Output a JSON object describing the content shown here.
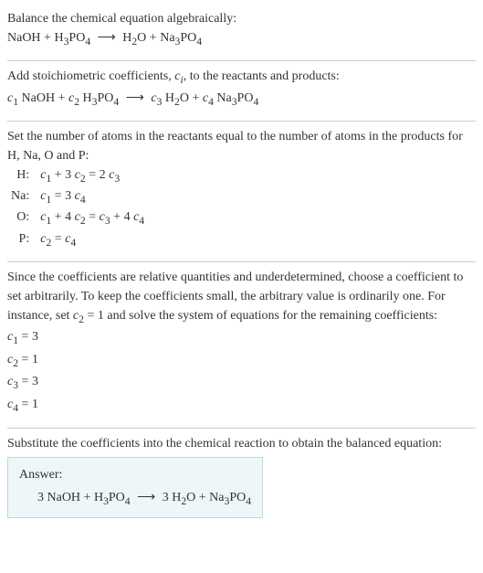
{
  "sec1": {
    "title": "Balance the chemical equation algebraically:",
    "eq_lhs1": "NaOH",
    "plus": " + ",
    "eq_lhs2": "H",
    "eq_lhs2_sub": "3",
    "eq_lhs2b": "PO",
    "eq_lhs2b_sub": "4",
    "arrow": "⟶",
    "eq_rhs1": "H",
    "eq_rhs1_sub": "2",
    "eq_rhs1b": "O",
    "eq_rhs2": "Na",
    "eq_rhs2_sub": "3",
    "eq_rhs2b": "PO",
    "eq_rhs2b_sub": "4"
  },
  "sec2": {
    "title_a": "Add stoichiometric coefficients, ",
    "title_c": "c",
    "title_i": "i",
    "title_b": ", to the reactants and products:",
    "c1": "c",
    "c1s": "1",
    "sp1": " NaOH",
    "c2": "c",
    "c2s": "2",
    "sp2a": " H",
    "sp2as": "3",
    "sp2b": "PO",
    "sp2bs": "4",
    "c3": "c",
    "c3s": "3",
    "sp3a": " H",
    "sp3as": "2",
    "sp3b": "O",
    "c4": "c",
    "c4s": "4",
    "sp4a": " Na",
    "sp4as": "3",
    "sp4b": "PO",
    "sp4bs": "4"
  },
  "sec3": {
    "title": "Set the number of atoms in the reactants equal to the number of atoms in the products for H, Na, O and P:",
    "rows": {
      "h_label": "H:",
      "h_eq_a": "c",
      "h_eq_as": "1",
      "h_eq_b": " + 3 ",
      "h_eq_c": "c",
      "h_eq_cs": "2",
      "h_eq_d": " = 2 ",
      "h_eq_e": "c",
      "h_eq_es": "3",
      "na_label": "Na:",
      "na_eq_a": "c",
      "na_eq_as": "1",
      "na_eq_b": " = 3 ",
      "na_eq_c": "c",
      "na_eq_cs": "4",
      "o_label": "O:",
      "o_eq_a": "c",
      "o_eq_as": "1",
      "o_eq_b": " + 4 ",
      "o_eq_c": "c",
      "o_eq_cs": "2",
      "o_eq_d": " = ",
      "o_eq_e": "c",
      "o_eq_es": "3",
      "o_eq_f": " + 4 ",
      "o_eq_g": "c",
      "o_eq_gs": "4",
      "p_label": "P:",
      "p_eq_a": "c",
      "p_eq_as": "2",
      "p_eq_b": " = ",
      "p_eq_c": "c",
      "p_eq_cs": "4"
    }
  },
  "sec4": {
    "title_a": "Since the coefficients are relative quantities and underdetermined, choose a coefficient to set arbitrarily. To keep the coefficients small, the arbitrary value is ordinarily one. For instance, set ",
    "title_c": "c",
    "title_cs": "2",
    "title_b": " = 1 and solve the system of equations for the remaining coefficients:",
    "l1a": "c",
    "l1s": "1",
    "l1b": " = 3",
    "l2a": "c",
    "l2s": "2",
    "l2b": " = 1",
    "l3a": "c",
    "l3s": "3",
    "l3b": " = 3",
    "l4a": "c",
    "l4s": "4",
    "l4b": " = 1"
  },
  "sec5": {
    "title": "Substitute the coefficients into the chemical reaction to obtain the balanced equation:",
    "answer_label": "Answer:",
    "eq_a": "3 NaOH + H",
    "eq_as": "3",
    "eq_b": "PO",
    "eq_bs": "4",
    "arrow": "⟶",
    "eq_c": "3 H",
    "eq_cs": "2",
    "eq_d": "O + Na",
    "eq_ds": "3",
    "eq_e": "PO",
    "eq_es": "4"
  }
}
